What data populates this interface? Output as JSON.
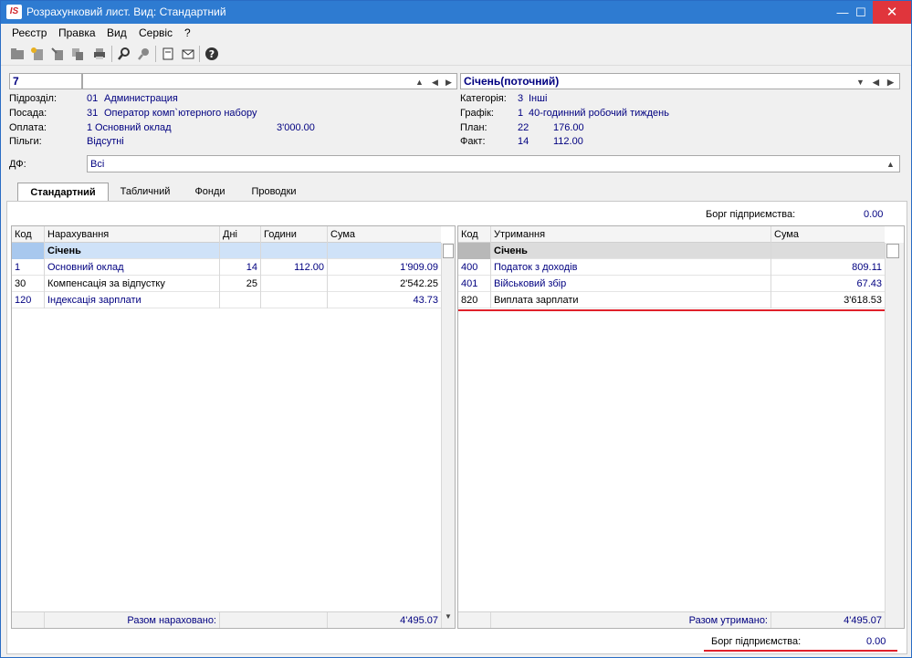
{
  "window": {
    "logo": "IS",
    "title": "Розрахунковий лист. Вид: Стандартний",
    "min_icon": "minimize-icon",
    "max_icon": "maximize-icon",
    "close_icon": "close-icon"
  },
  "menu": [
    "Реєстр",
    "Правка",
    "Вид",
    "Сервіс",
    "?"
  ],
  "toolbar": [
    "open-folder-icon",
    "new-document-icon",
    "edit-icon",
    "copy-icon",
    "print-icon",
    "search-icon",
    "filter-icon",
    "document-icon",
    "mail-icon",
    "help-icon"
  ],
  "header": {
    "person_number": "7",
    "period": "Січень(поточний)",
    "left": [
      {
        "label": "Підрозділ:",
        "code": "01",
        "name": "Администрация",
        "extra": ""
      },
      {
        "label": "Посада:",
        "code": "31",
        "name": "Оператор комп`ютерного набору",
        "extra": ""
      },
      {
        "label": "Оплата:",
        "code": "1",
        "name": "Основний оклад",
        "extra": "3'000.00"
      },
      {
        "label": "Пільги:",
        "code": "",
        "name": "Відсутні",
        "extra": ""
      }
    ],
    "right": [
      {
        "label": "Категорія:",
        "code": "3",
        "name": "Інші"
      },
      {
        "label": "Графік:",
        "code": "1",
        "name": "40-годинний робочий тиждень"
      },
      {
        "label": "План:",
        "code": "22",
        "name": "176.00"
      },
      {
        "label": "Факт:",
        "code": "14",
        "name": "112.00"
      }
    ],
    "df_label": "ДФ:",
    "df_value": "Всі"
  },
  "tabs": [
    "Стандартний",
    "Табличний",
    "Фонди",
    "Проводки"
  ],
  "debt_top": {
    "label": "Борг підприємства:",
    "value": "0.00"
  },
  "accruals": {
    "columns": [
      "Код",
      "Нарахування",
      "Дні",
      "Години",
      "Сума"
    ],
    "group": "Січень",
    "rows": [
      {
        "code": "1",
        "name": "Основний оклад",
        "days": "14",
        "hours": "112.00",
        "sum": "1'909.09",
        "blue": true
      },
      {
        "code": "30",
        "name": "Компенсація за відпустку",
        "days": "25",
        "hours": "",
        "sum": "2'542.25",
        "blue": false
      },
      {
        "code": "120",
        "name": "Індексація зарплати",
        "days": "",
        "hours": "",
        "sum": "43.73",
        "blue": true
      }
    ],
    "total_label": "Разом нараховано:",
    "total": "4'495.07"
  },
  "deductions": {
    "columns": [
      "Код",
      "Утримання",
      "Сума"
    ],
    "group": "Січень",
    "rows": [
      {
        "code": "400",
        "name": "Податок з доходів",
        "sum": "809.11",
        "blue": true
      },
      {
        "code": "401",
        "name": "Військовий збір",
        "sum": "67.43",
        "blue": true
      },
      {
        "code": "820",
        "name": "Виплата зарплати",
        "sum": "3'618.53",
        "blue": false
      }
    ],
    "total_label": "Разом утримано:",
    "total": "4'495.07"
  },
  "debt_bottom": {
    "label": "Борг підприємства:",
    "value": "0.00"
  }
}
